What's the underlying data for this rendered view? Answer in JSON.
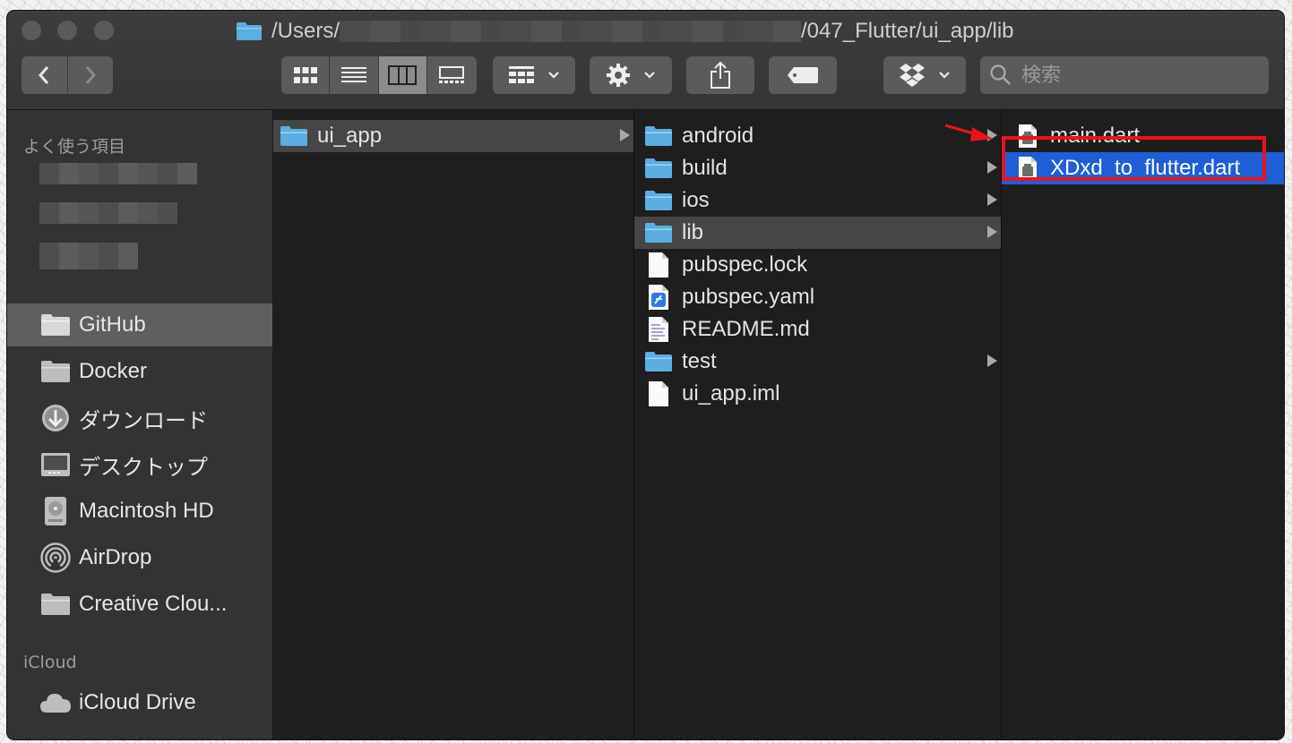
{
  "window": {
    "title_prefix": "/Users/",
    "title_suffix": "/047_Flutter/ui_app/lib"
  },
  "toolbar": {
    "search_placeholder": "検索"
  },
  "sidebar": {
    "favorites_heading": "よく使う項目",
    "favorites": [
      {
        "label": "GitHub",
        "icon": "folder-icon",
        "selected": true
      },
      {
        "label": "Docker",
        "icon": "folder-icon"
      },
      {
        "label": "ダウンロード",
        "icon": "download-icon"
      },
      {
        "label": "デスクトップ",
        "icon": "desktop-icon"
      },
      {
        "label": "Macintosh HD",
        "icon": "hard-drive-icon"
      },
      {
        "label": "AirDrop",
        "icon": "airdrop-icon"
      },
      {
        "label": "Creative Clou...",
        "icon": "folder-icon"
      }
    ],
    "icloud_heading": "iCloud",
    "icloud": [
      {
        "label": "iCloud Drive",
        "icon": "cloud-icon"
      }
    ]
  },
  "columns": [
    {
      "items": [
        {
          "label": "ui_app",
          "type": "folder",
          "highlighted": true,
          "has_children": true
        }
      ]
    },
    {
      "items": [
        {
          "label": "android",
          "type": "folder",
          "has_children": true
        },
        {
          "label": "build",
          "type": "folder",
          "has_children": true
        },
        {
          "label": "ios",
          "type": "folder",
          "has_children": true
        },
        {
          "label": "lib",
          "type": "folder",
          "highlighted": true,
          "has_children": true
        },
        {
          "label": "pubspec.lock",
          "type": "file"
        },
        {
          "label": "pubspec.yaml",
          "type": "xcode-file"
        },
        {
          "label": "README.md",
          "type": "text-file"
        },
        {
          "label": "test",
          "type": "folder",
          "has_children": true
        },
        {
          "label": "ui_app.iml",
          "type": "file"
        }
      ]
    },
    {
      "items": [
        {
          "label": "main.dart",
          "type": "dart-file"
        },
        {
          "label": "XDxd_to_flutter.dart",
          "type": "dart-file",
          "selected": true
        }
      ]
    }
  ],
  "colors": {
    "selection": "#1f5ed6",
    "annotation": "#e8141c",
    "folder": "#5aaee0"
  }
}
